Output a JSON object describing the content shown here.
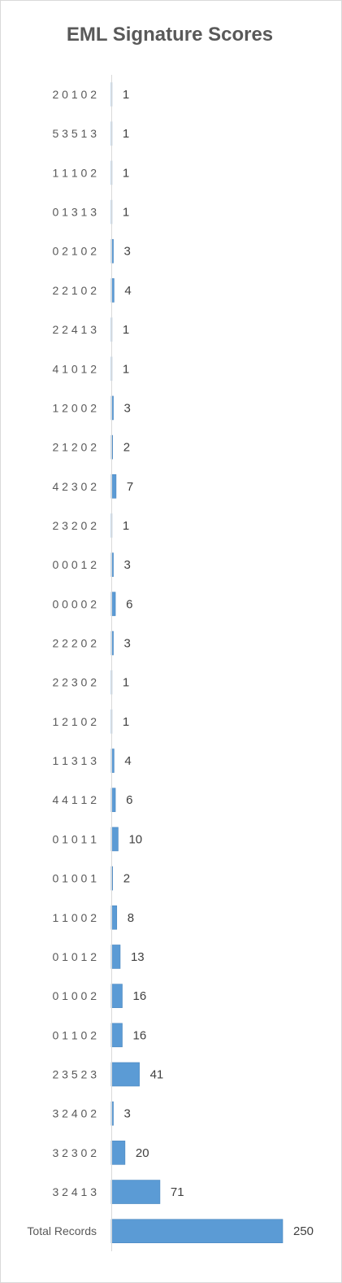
{
  "chart_data": {
    "type": "bar",
    "orientation": "horizontal",
    "title": "EML Signature Scores",
    "categories": [
      "2 0 1 0 2",
      "5 3 5 1 3",
      "1 1 1 0 2",
      "0 1 3 1 3",
      "0 2 1 0 2",
      "2 2 1 0 2",
      "2 2 4 1 3",
      "4 1 0 1 2",
      "1 2 0 0 2",
      "2 1 2 0 2",
      "4 2 3 0 2",
      "2 3 2 0 2",
      "0 0 0 1 2",
      "0 0 0 0 2",
      "2 2 2 0 2",
      "2 2 3 0 2",
      "1 2 1 0 2",
      "1 1 3 1 3",
      "4 4 1 1 2",
      "0 1 0 1 1",
      "0 1 0 0 1",
      "1 1 0 0 2",
      "0 1 0 1 2",
      "0 1 0 0 2",
      "0 1 1 0 2",
      "2 3 5 2 3",
      "3 2 4 0 2",
      "3 2 3 0 2",
      "3 2 4 1 3",
      "Total Records"
    ],
    "values": [
      1,
      1,
      1,
      1,
      3,
      4,
      1,
      1,
      3,
      2,
      7,
      1,
      3,
      6,
      3,
      1,
      1,
      4,
      6,
      10,
      2,
      8,
      13,
      16,
      16,
      41,
      3,
      20,
      71,
      250
    ],
    "xlim": [
      0,
      250
    ],
    "data_labels": true,
    "gridlines": false,
    "legend": "none",
    "colors": {
      "bar_fill": "#5b9bd5",
      "bar_stroke": "#4a87c0",
      "axis": "#d9d9d9",
      "text": "#595959"
    }
  }
}
